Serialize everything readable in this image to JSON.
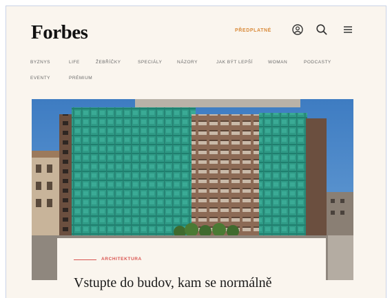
{
  "header": {
    "logo": "Forbes",
    "subscribe_label": "PŘEDPLATNÉ",
    "icons": [
      "user-icon",
      "search-icon",
      "menu-icon"
    ]
  },
  "nav": {
    "row1": [
      "BYZNYS",
      "LIFE",
      "ŽEBŘÍČKY",
      "SPECIÁLY",
      "NÁZORY",
      "JAK BÝT LEPŠÍ",
      "WOMAN",
      "PODCASTY"
    ],
    "row2": [
      "EVENTY",
      "PRÉMIUM"
    ]
  },
  "article": {
    "category": "ARCHITEKTURA",
    "title": "Vstupte do budov, kam se normálně"
  },
  "colors": {
    "accent": "#d9534f",
    "subscribe": "#d98a3a",
    "background": "#faf5ee",
    "sky": "#4e87c8",
    "scaffold_net": "#2f9a86"
  }
}
